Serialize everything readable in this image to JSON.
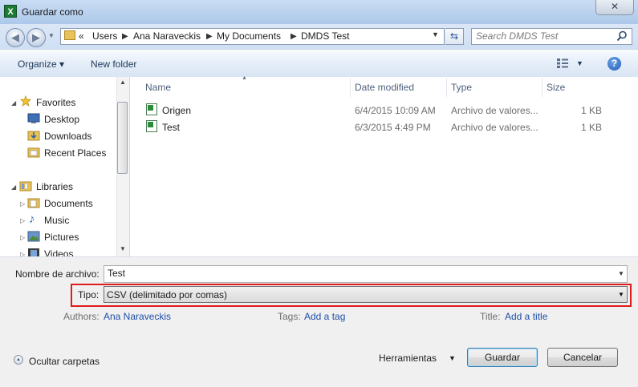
{
  "window": {
    "title": "Guardar como",
    "close_symbol": "✕",
    "app_icon_letter": "X"
  },
  "address": {
    "overflow": "«",
    "crumbs": [
      "Users",
      "Ana Naraveckis",
      "My Documents",
      "DMDS Test"
    ],
    "separator": "▶"
  },
  "search": {
    "placeholder": "Search DMDS Test"
  },
  "toolbar": {
    "organize": "Organize ▾",
    "new_folder": "New folder",
    "view_drop": "▼",
    "help": "?"
  },
  "nav": {
    "favorites": {
      "label": "Favorites",
      "items": [
        "Desktop",
        "Downloads",
        "Recent Places"
      ]
    },
    "libraries": {
      "label": "Libraries",
      "items": [
        "Documents",
        "Music",
        "Pictures",
        "Videos"
      ]
    }
  },
  "columns": {
    "name": "Name",
    "date": "Date modified",
    "type": "Type",
    "size": "Size"
  },
  "files": [
    {
      "name": "Origen",
      "date": "6/4/2015 10:09 AM",
      "type": "Archivo de valores...",
      "size": "1 KB"
    },
    {
      "name": "Test",
      "date": "6/3/2015 4:49 PM",
      "type": "Archivo de valores...",
      "size": "1 KB"
    }
  ],
  "form": {
    "filename_label": "Nombre de archivo:",
    "filename_value": "Test",
    "type_label": "Tipo:",
    "type_value": "CSV (delimitado por comas)",
    "authors_label": "Authors:",
    "authors_value": "Ana Naraveckis",
    "tags_label": "Tags:",
    "tags_value": "Add a tag",
    "title_label": "Title:",
    "title_value": "Add a title"
  },
  "footer": {
    "hide_folders": "Ocultar carpetas",
    "tools": "Herramientas",
    "save": "Guardar",
    "cancel": "Cancelar"
  },
  "colors": {
    "highlight": "#e01b1b",
    "link": "#1f4fa8",
    "toolbar_text": "#1e395b"
  }
}
